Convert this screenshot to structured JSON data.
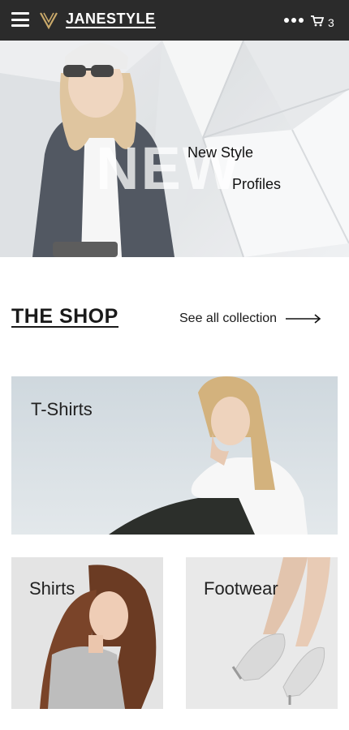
{
  "header": {
    "brand": "JANESTYLE",
    "cart_count": "3",
    "icons": {
      "menu": "hamburger-icon",
      "logo": "logo-mark-icon",
      "more": "more-dots-icon",
      "cart": "cart-icon"
    }
  },
  "hero": {
    "watermark": "NEW",
    "line1": "New Style",
    "line2": "Profiles"
  },
  "shop": {
    "title": "THE SHOP",
    "see_all": "See all collection"
  },
  "categories": [
    {
      "label": "T-Shirts"
    },
    {
      "label": "Shirts"
    },
    {
      "label": "Footwear"
    }
  ]
}
